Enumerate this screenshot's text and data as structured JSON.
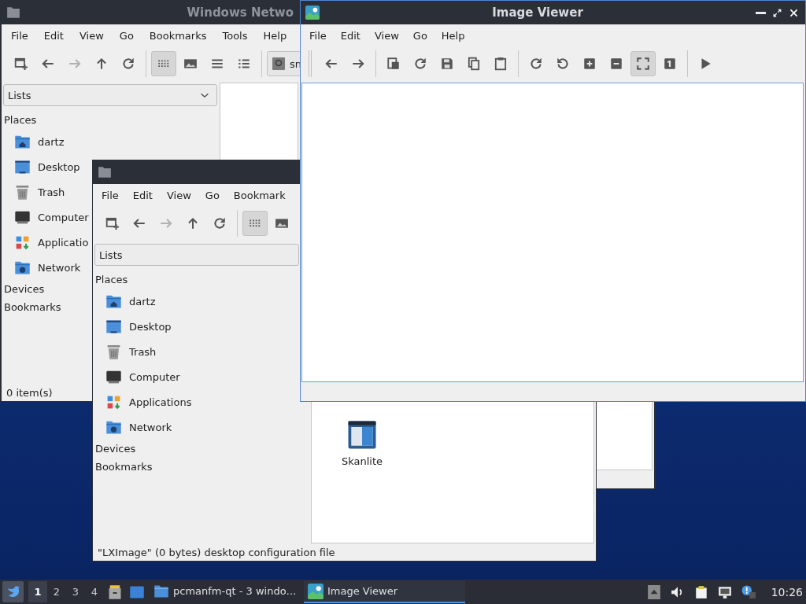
{
  "network_window": {
    "title": "Windows Netwo",
    "menu": [
      "File",
      "Edit",
      "View",
      "Go",
      "Bookmarks",
      "Tools",
      "Help"
    ],
    "toolbar_groups": [
      {
        "buttons": [
          {
            "kind": "new-tab",
            "selected": false,
            "disabled": false
          },
          {
            "kind": "back",
            "selected": false,
            "disabled": false
          },
          {
            "kind": "forward",
            "selected": false,
            "disabled": true
          },
          {
            "kind": "up",
            "selected": false,
            "disabled": false
          },
          {
            "kind": "reload",
            "selected": false,
            "disabled": false
          }
        ]
      },
      {
        "buttons": [
          {
            "kind": "icon-view",
            "selected": true,
            "disabled": false
          },
          {
            "kind": "thumbnail",
            "selected": false,
            "disabled": false
          },
          {
            "kind": "compact",
            "selected": false,
            "disabled": false
          },
          {
            "kind": "detailed",
            "selected": false,
            "disabled": false
          }
        ]
      }
    ],
    "search": {
      "value": "sn"
    },
    "side_panel": {
      "view": "Lists",
      "sections": [
        {
          "title": "Places",
          "items": [
            {
              "kind": "home",
              "label": "dartz"
            },
            {
              "kind": "desktop",
              "label": "Desktop"
            },
            {
              "kind": "trash",
              "label": "Trash"
            },
            {
              "kind": "computer",
              "label": "Computer"
            },
            {
              "kind": "applications",
              "label": "Applicatio"
            },
            {
              "kind": "network",
              "label": "Network"
            }
          ]
        },
        {
          "title": "Devices"
        },
        {
          "title": "Bookmarks"
        }
      ]
    },
    "status": "0 item(s)"
  },
  "desktop_window": {
    "menu": [
      "File",
      "Edit",
      "View",
      "Go",
      "Bookmark"
    ],
    "toolbar_groups": [
      {
        "buttons": [
          {
            "kind": "new-tab",
            "selected": false,
            "disabled": false
          },
          {
            "kind": "back",
            "selected": false,
            "disabled": false
          },
          {
            "kind": "forward",
            "selected": false,
            "disabled": true
          },
          {
            "kind": "up",
            "selected": false,
            "disabled": false
          },
          {
            "kind": "reload",
            "selected": false,
            "disabled": false
          }
        ]
      },
      {
        "buttons": [
          {
            "kind": "icon-view",
            "selected": true,
            "disabled": false
          },
          {
            "kind": "thumbnail",
            "selected": false,
            "disabled": false
          }
        ]
      }
    ],
    "side_panel": {
      "view": "Lists",
      "sections": [
        {
          "title": "Places",
          "items": [
            {
              "kind": "home",
              "label": "dartz"
            },
            {
              "kind": "desktop",
              "label": "Desktop"
            },
            {
              "kind": "trash",
              "label": "Trash"
            },
            {
              "kind": "computer",
              "label": "Computer"
            },
            {
              "kind": "applications",
              "label": "Applications"
            },
            {
              "kind": "network",
              "label": "Network"
            }
          ]
        },
        {
          "title": "Devices"
        },
        {
          "title": "Bookmarks"
        }
      ]
    },
    "files": [
      {
        "kind": "application",
        "name": "Skanlite"
      }
    ],
    "status": "\"LXImage\" (0 bytes) desktop configuration file"
  },
  "image_viewer": {
    "title": "Image Viewer",
    "menu": [
      "File",
      "Edit",
      "View",
      "Go",
      "Help"
    ],
    "toolbar_groups": [
      {
        "buttons": [
          {
            "kind": "back",
            "selected": false,
            "disabled": false
          },
          {
            "kind": "forward",
            "selected": false,
            "disabled": false
          }
        ]
      },
      {
        "buttons": [
          {
            "kind": "open",
            "selected": false,
            "disabled": false
          },
          {
            "kind": "reload",
            "selected": false,
            "disabled": false
          },
          {
            "kind": "save-as",
            "selected": false,
            "disabled": false
          },
          {
            "kind": "copy",
            "selected": false,
            "disabled": false
          },
          {
            "kind": "paste",
            "selected": false,
            "disabled": false
          }
        ]
      },
      {
        "buttons": [
          {
            "kind": "rotate-cw",
            "selected": false,
            "disabled": false
          },
          {
            "kind": "rotate-ccw",
            "selected": false,
            "disabled": false
          },
          {
            "kind": "zoom-in",
            "selected": false,
            "disabled": false
          },
          {
            "kind": "zoom-out",
            "selected": false,
            "disabled": false
          },
          {
            "kind": "fit",
            "selected": true,
            "disabled": false
          },
          {
            "kind": "original",
            "selected": false,
            "disabled": false
          }
        ]
      },
      {
        "buttons": [
          {
            "kind": "slideshow",
            "selected": false,
            "disabled": false
          }
        ]
      }
    ]
  },
  "taskbar": {
    "workspaces": [
      {
        "label": "1",
        "selected": true
      },
      {
        "label": "2",
        "selected": false
      },
      {
        "label": "3",
        "selected": false
      },
      {
        "label": "4",
        "selected": false
      }
    ],
    "tasks": [
      {
        "kind": "folder",
        "title": "pcmanfm-qt - 3 windo…",
        "selected": false
      },
      {
        "kind": "viewer",
        "title": "Image Viewer",
        "selected": true
      }
    ],
    "clock": "10:26"
  }
}
